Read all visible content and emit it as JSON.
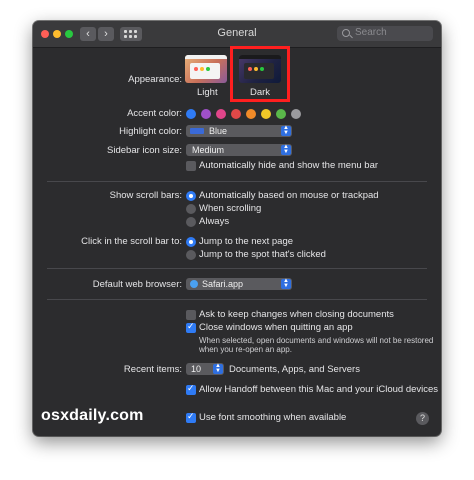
{
  "window": {
    "title": "General"
  },
  "toolbar": {
    "search_placeholder": "Search",
    "back_glyph": "‹",
    "forward_glyph": "›"
  },
  "appearance": {
    "label": "Appearance:",
    "options": [
      "Light",
      "Dark"
    ],
    "selected": "Dark"
  },
  "accent_color": {
    "label": "Accent color:",
    "colors": [
      "#9a9a9e",
      "#a050c8",
      "#e0458a",
      "#e04848",
      "#f08a28",
      "#f0c828",
      "#5ab84a",
      "#9a9a9e"
    ]
  },
  "highlight_color": {
    "label": "Highlight color:",
    "value": "Blue"
  },
  "sidebar_icon_size": {
    "label": "Sidebar icon size:",
    "value": "Medium"
  },
  "menu_bar": {
    "label": "Automatically hide and show the menu bar",
    "checked": false
  },
  "scroll_bars": {
    "label": "Show scroll bars:",
    "options": [
      "Automatically based on mouse or trackpad",
      "When scrolling",
      "Always"
    ]
  },
  "click_scroll": {
    "label": "Click in the scroll bar to:",
    "options": [
      "Jump to the next page",
      "Jump to the spot that's clicked"
    ]
  },
  "browser": {
    "label": "Default web browser:",
    "value": "Safari.app"
  },
  "ask_keep_changes": {
    "label": "Ask to keep changes when closing documents",
    "checked": false
  },
  "close_windows": {
    "label": "Close windows when quitting an app",
    "checked": true,
    "note_line1": "When selected, open documents and windows will not be restored",
    "note_line2": "when you re-open an app."
  },
  "recent_items": {
    "label": "Recent items:",
    "value": "10",
    "suffix": "Documents, Apps, and Servers"
  },
  "handoff": {
    "label": "Allow Handoff between this Mac and your iCloud devices",
    "checked": true
  },
  "font_smoothing": {
    "label": "Use font smoothing when available",
    "checked": true
  },
  "watermark": "osxdaily.com",
  "help_glyph": "?"
}
